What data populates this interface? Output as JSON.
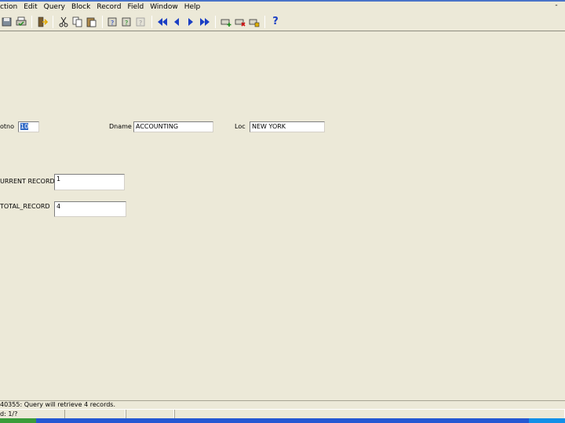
{
  "menubar": {
    "items": [
      "ction",
      "Edit",
      "Query",
      "Block",
      "Record",
      "Field",
      "Window",
      "Help"
    ],
    "window_control": "-"
  },
  "toolbar": {
    "icons": [
      "save-icon",
      "print-icon",
      "exit-icon",
      "cut-icon",
      "copy-icon",
      "paste-icon",
      "enter-query-icon",
      "execute-query-icon",
      "cancel-query-icon",
      "first-record-icon",
      "previous-record-icon",
      "next-record-icon",
      "last-record-icon",
      "insert-record-icon",
      "delete-record-icon",
      "lock-record-icon",
      "help-icon"
    ],
    "help_glyph": "?"
  },
  "form": {
    "deptno_label": "otno",
    "deptno_value": "10",
    "dname_label": "Dname",
    "dname_value": "ACCOUNTING",
    "loc_label": "Loc",
    "loc_value": "NEW YORK",
    "current_record_label": "URRENT RECORD",
    "current_record_value": "1",
    "total_record_label": "TOTAL_RECORD",
    "total_record_value": "4"
  },
  "status": {
    "message": "40355: Query will retrieve 4 records.",
    "record_indicator": "d: 1/?"
  }
}
